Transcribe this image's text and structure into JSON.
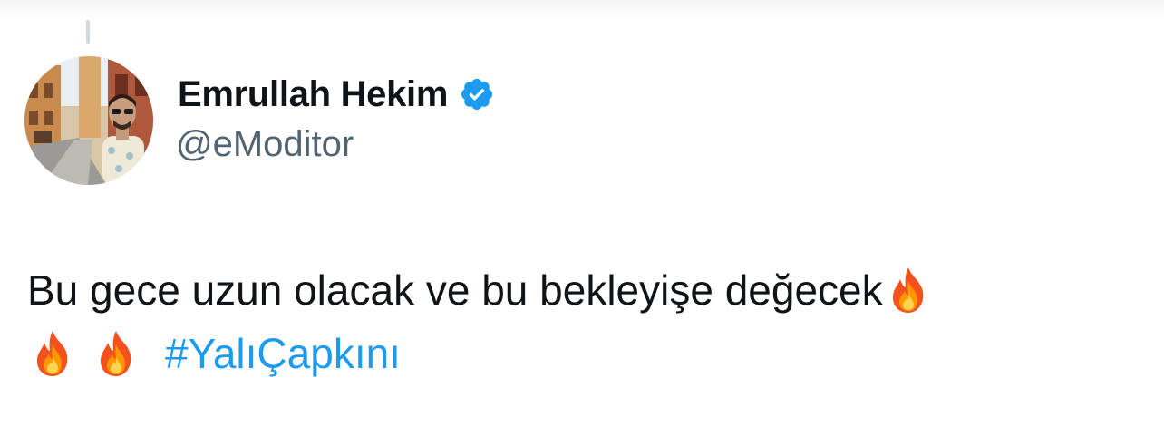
{
  "author": {
    "display_name": "Emrullah Hekim",
    "handle": "@eModitor",
    "verified": true,
    "avatar": "profile-photo"
  },
  "tweet": {
    "text": "Bu gece uzun olacak ve bu bekleyişe değecek",
    "emoji": [
      "fire-emoji",
      "fire-emoji",
      "fire-emoji"
    ],
    "hashtag": "#YalıÇapkını"
  },
  "colors": {
    "name": "#0f1419",
    "handle": "#536471",
    "hashtag": "#1d9bf0",
    "verified": "#1d9bf0"
  }
}
